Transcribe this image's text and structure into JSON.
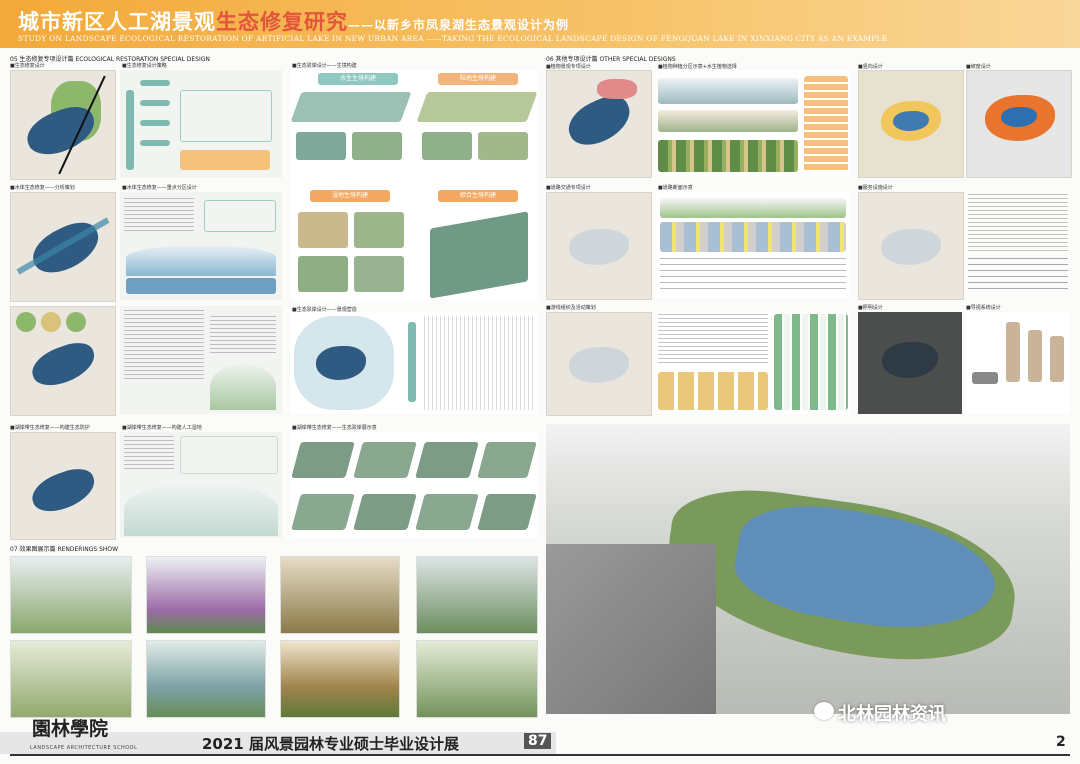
{
  "header": {
    "title_a": "城市新区人工湖景观",
    "title_b": "生态修复研究",
    "title_c": "——以新乡市凤泉湖生态景观设计为例",
    "title_en": "STUDY ON LANDSCAPE ECOLOGICAL RESTORATION OF ARTIFICIAL LAKE IN NEW URBAN AREA ——TAKING THE ECOLOGICAL LANDSCAPE DESIGN OF FENGQUAN LAKE IN XINXIANG CITY AS AN EXAMPLE"
  },
  "sections": {
    "s05": "05 生态修复专项设计篇  ECOLOGICAL RESTORATION SPECIAL DESIGN",
    "s06": "06 其他专项设计篇  OTHER SPECIAL DESIGNS",
    "s07": "07 效果图展示篇  RENDERINGS SHOW"
  },
  "sub_titles": {
    "a1": "■生态修复设计",
    "a2": "■生态修复设计策略",
    "a3": "■水体生态修复——分析策划",
    "a4": "■水体生态修复——重点分区设计",
    "a5": "■生态驳岸设计——生境构建",
    "a6": "■生态驳岸设计——景观营造",
    "a7": "■湖岸带生态修复——构建生态防护",
    "a8": "■湖岸带生态修复——构建人工湿地",
    "a9": "■湖岸带生态修复——生态驳岸展示意",
    "b1": "■植物景观专项设计",
    "b2": "■植物种植分区示意+水生植物选择",
    "b3": "■竖向设计",
    "b4": "■坡度设计",
    "b5": "■道路交通专项设计",
    "b6": "■道路断面示意",
    "b7": "■服务设施设计",
    "b8": "■游线组织及活动策划",
    "b9": "■照明设计",
    "b10": "■导视系统设计"
  },
  "habitat_labels": {
    "h1": "水生生境构建",
    "h2": "陆地生境构建",
    "h3": "湿地生境构建",
    "h4": "综合生境构建"
  },
  "footer": {
    "logo_text": "園林學院",
    "logo_en": "LANDSCAPE ARCHITECTURE SCHOOL",
    "expo": "2021 届风景园林专业硕士毕业设计展",
    "page_no": "87",
    "page_right": "2"
  },
  "watermark": "北林园林资讯",
  "colors": {
    "header": "#f3a93a",
    "highlight": "#e3553a",
    "lake": "#2f5b83",
    "green": "#8db76a"
  }
}
